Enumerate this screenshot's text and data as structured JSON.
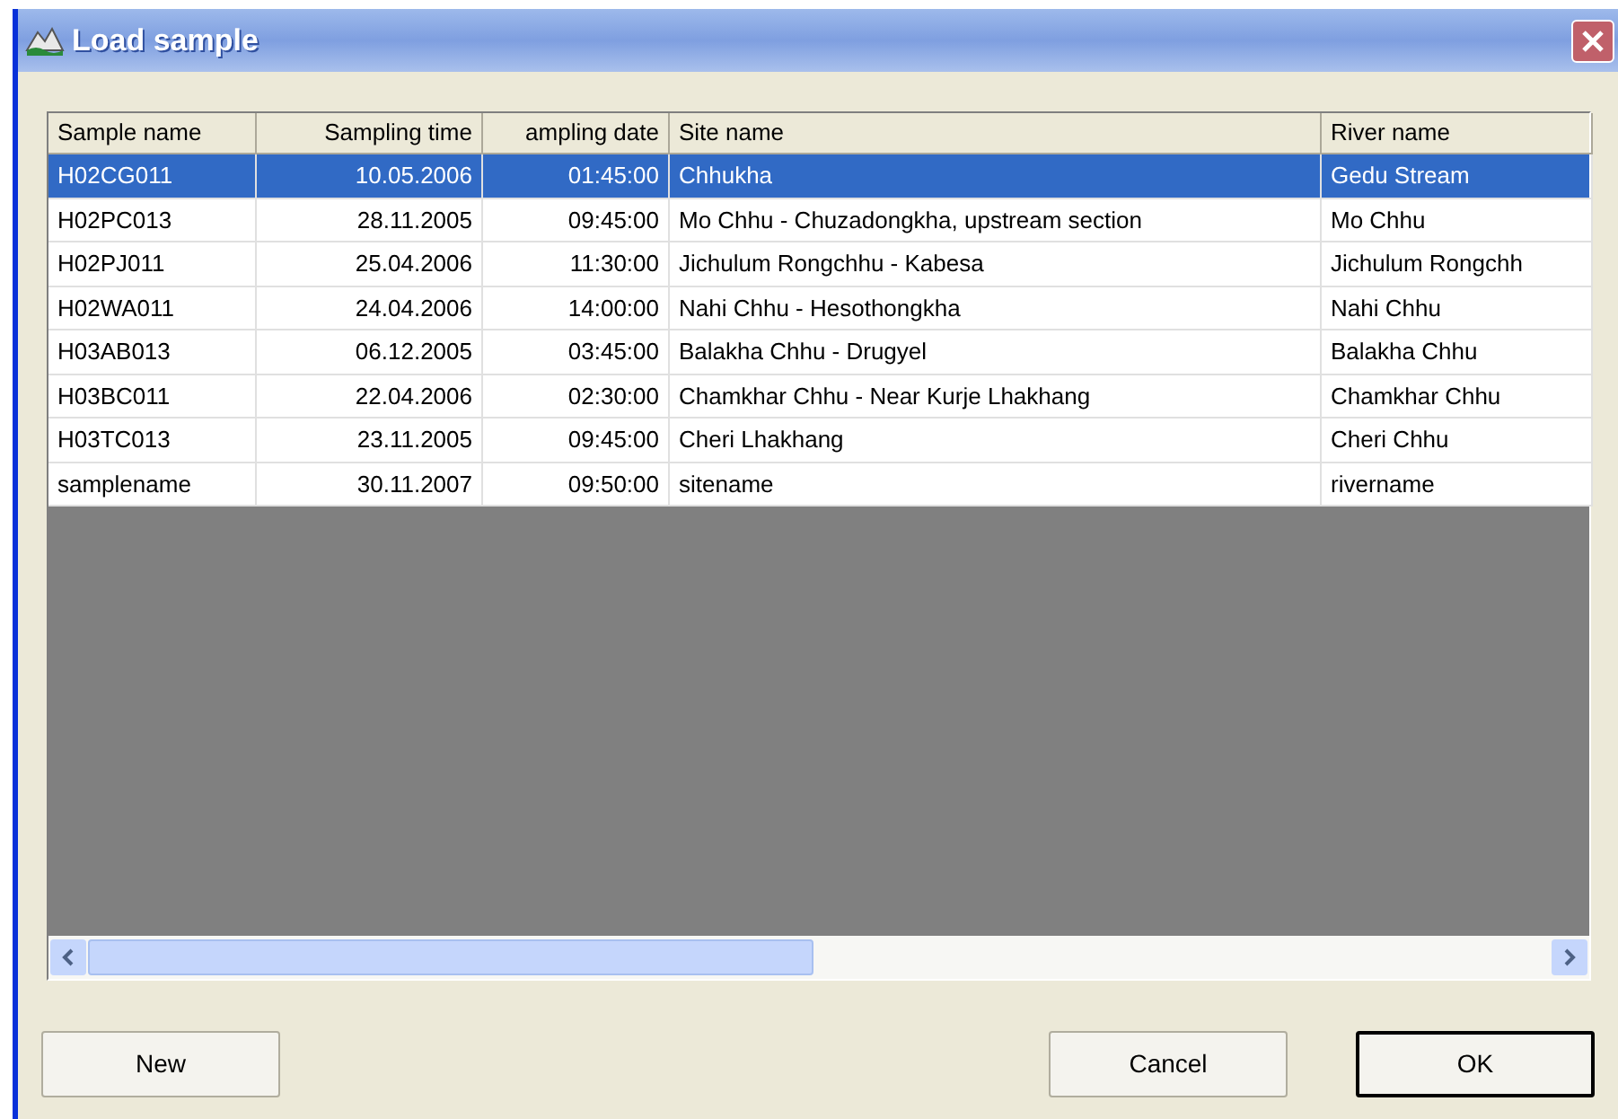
{
  "window": {
    "title": "Load sample"
  },
  "table": {
    "columns": [
      "Sample name",
      "Sampling time",
      "ampling date",
      "Site name",
      "River name"
    ],
    "rows": [
      {
        "cells": [
          "H02CG011",
          "10.05.2006",
          "01:45:00",
          "Chhukha",
          "Gedu Stream"
        ],
        "selected": true
      },
      {
        "cells": [
          "H02PC013",
          "28.11.2005",
          "09:45:00",
          "Mo Chhu - Chuzadongkha, upstream section",
          "Mo Chhu"
        ],
        "selected": false
      },
      {
        "cells": [
          "H02PJ011",
          "25.04.2006",
          "11:30:00",
          "Jichulum Rongchhu - Kabesa",
          "Jichulum Rongchh"
        ],
        "selected": false
      },
      {
        "cells": [
          "H02WA011",
          "24.04.2006",
          "14:00:00",
          "Nahi Chhu - Hesothongkha",
          "Nahi Chhu"
        ],
        "selected": false
      },
      {
        "cells": [
          "H03AB013",
          "06.12.2005",
          "03:45:00",
          "Balakha Chhu - Drugyel",
          "Balakha Chhu"
        ],
        "selected": false
      },
      {
        "cells": [
          "H03BC011",
          "22.04.2006",
          "02:30:00",
          "Chamkhar Chhu  - Near Kurje Lhakhang",
          "Chamkhar Chhu"
        ],
        "selected": false
      },
      {
        "cells": [
          "H03TC013",
          "23.11.2005",
          "09:45:00",
          "Cheri Lhakhang",
          "Cheri Chhu"
        ],
        "selected": false
      },
      {
        "cells": [
          "samplename",
          "30.11.2007",
          "09:50:00",
          "sitename",
          "rivername"
        ],
        "selected": false
      }
    ]
  },
  "buttons": [
    "New",
    "Cancel",
    "OK"
  ]
}
